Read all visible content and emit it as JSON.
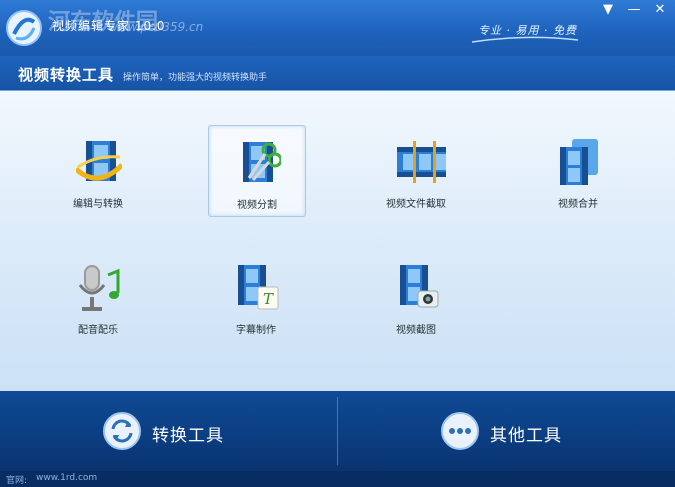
{
  "titlebar": {
    "app_title": "视频编辑专家 10.0",
    "watermark": "河东软件园",
    "watermark_url": "www.pc0359.cn",
    "slogan": "专业 · 易用 · 免费"
  },
  "window_controls": {
    "menu": "▼",
    "minimize": "—",
    "close": "✕"
  },
  "subheader": {
    "title": "视频转换工具",
    "description": "操作简单，功能强大的视频转换助手"
  },
  "tools": [
    {
      "label": "编辑与转换",
      "icon": "film-convert-icon",
      "selected": false
    },
    {
      "label": "视频分割",
      "icon": "film-scissors-icon",
      "selected": true
    },
    {
      "label": "视频文件截取",
      "icon": "film-trim-icon",
      "selected": false
    },
    {
      "label": "视频合并",
      "icon": "film-merge-icon",
      "selected": false
    },
    {
      "label": "配音配乐",
      "icon": "microphone-music-icon",
      "selected": false
    },
    {
      "label": "字幕制作",
      "icon": "film-subtitle-icon",
      "selected": false
    },
    {
      "label": "视频截图",
      "icon": "film-camera-icon",
      "selected": false
    }
  ],
  "bottom": {
    "convert_label": "转换工具",
    "other_label": "其他工具"
  },
  "status": {
    "label": "官网:",
    "url": "www.1rd.com"
  },
  "colors": {
    "title_bar": "#1f63bd",
    "panel": "#dcebf9",
    "bottom_bar": "#0b3d80",
    "film": "#2b7fd6"
  }
}
